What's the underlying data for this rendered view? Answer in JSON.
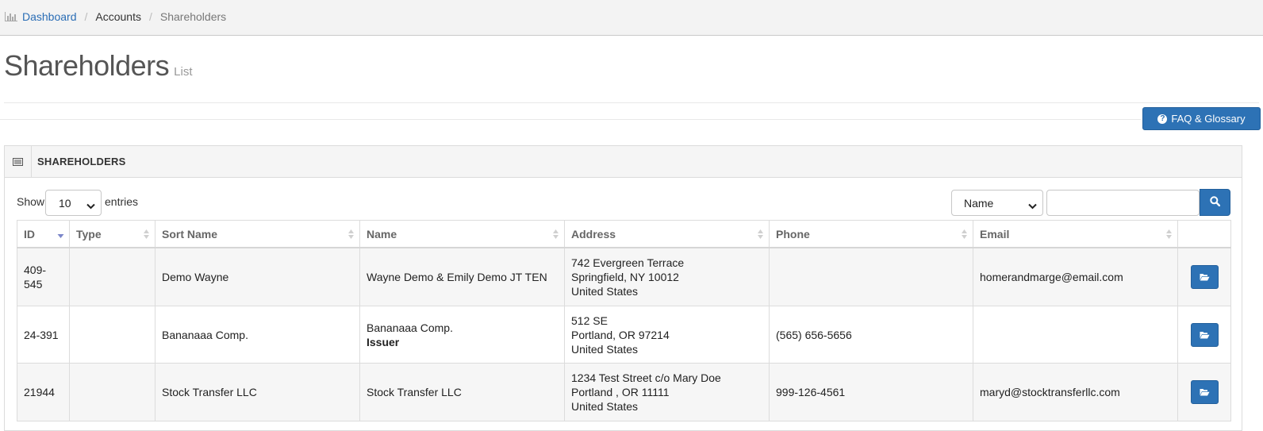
{
  "breadcrumb": {
    "dashboard": "Dashboard",
    "accounts": "Accounts",
    "current": "Shareholders",
    "separator": "/"
  },
  "page": {
    "title": "Shareholders",
    "subtitle": "List"
  },
  "faq_button": {
    "label": "FAQ & Glossary",
    "icon": "question-circle-icon"
  },
  "panel": {
    "title": "SHAREHOLDERS"
  },
  "controls": {
    "show_label": "Show",
    "entries_label": "entries",
    "page_length": "10",
    "search_field": "Name",
    "search_value": "",
    "search_icon": "search-icon"
  },
  "table": {
    "columns": [
      "ID",
      "Type",
      "Sort Name",
      "Name",
      "Address",
      "Phone",
      "Email",
      ""
    ],
    "rows": [
      {
        "id": "409-545",
        "type": "",
        "sort_name": "Demo Wayne",
        "name": "Wayne Demo & Emily Demo JT TEN",
        "name_sub": "",
        "address": [
          "742 Evergreen Terrace",
          "Springfield, NY 10012",
          "United States"
        ],
        "phone": "",
        "email": "homerandmarge@email.com"
      },
      {
        "id": "24-391",
        "type": "",
        "sort_name": "Bananaaa Comp.",
        "name": "Bananaaa Comp.",
        "name_sub": "Issuer",
        "address": [
          "512 SE",
          "Portland, OR 97214",
          "United States"
        ],
        "phone": "(565) 656-5656",
        "email": ""
      },
      {
        "id": "21944",
        "type": "",
        "sort_name": "Stock Transfer LLC",
        "name": "Stock Transfer LLC",
        "name_sub": "",
        "address": [
          "1234 Test Street c/o Mary Doe",
          "Portland , OR 11111",
          "United States"
        ],
        "phone": "999-126-4561",
        "email": "maryd@stocktransferllc.com"
      }
    ]
  },
  "colors": {
    "primary": "#2d72b5",
    "link": "#2a6db5",
    "stripe": "#f6f6f6",
    "header_bg": "#f3f3f3"
  }
}
